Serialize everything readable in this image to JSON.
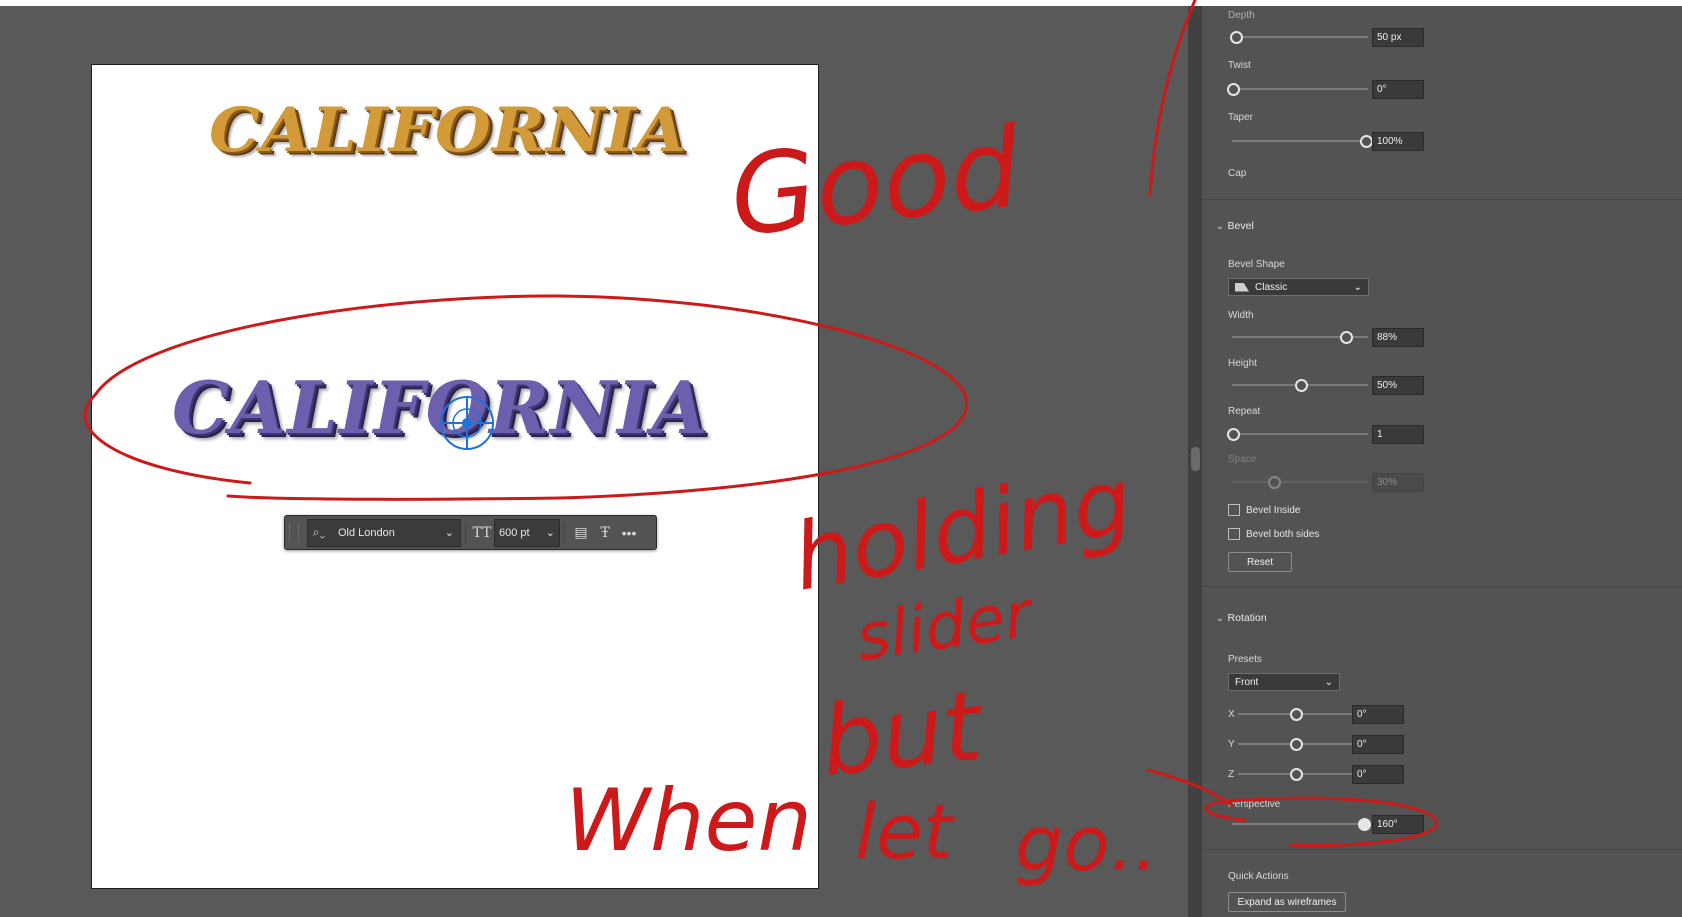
{
  "canvas": {
    "top_word": "CALIFORNIA",
    "bottom_word": "CALIFORNIA"
  },
  "context_bar": {
    "font_name": "Old London",
    "font_size": "600 pt"
  },
  "panel": {
    "depth": {
      "label": "Depth",
      "value": "50 px",
      "level": 0.02
    },
    "twist": {
      "label": "Twist",
      "value": "0°",
      "level": 0.0
    },
    "taper": {
      "label": "Taper",
      "value": "100%",
      "level": 1.0
    },
    "cap": {
      "label": "Cap"
    },
    "bevel": {
      "title": "Bevel",
      "shape_label": "Bevel Shape",
      "shape_value": "Classic",
      "width": {
        "label": "Width",
        "value": "88%",
        "level": 0.85
      },
      "height": {
        "label": "Height",
        "value": "50%",
        "level": 0.5
      },
      "repeat": {
        "label": "Repeat",
        "value": "1",
        "level": 0.0
      },
      "space": {
        "label": "Space",
        "value": "30%",
        "level": 0.3
      },
      "bevel_inside": "Bevel Inside",
      "bevel_both": "Bevel both sides",
      "reset": "Reset"
    },
    "rotation": {
      "title": "Rotation",
      "presets_label": "Presets",
      "preset_value": "Front",
      "x": {
        "label": "X",
        "value": "0°",
        "level": 0.5
      },
      "y": {
        "label": "Y",
        "value": "0°",
        "level": 0.5
      },
      "z": {
        "label": "Z",
        "value": "0°",
        "level": 0.5
      },
      "perspective": {
        "label": "Perspective",
        "value": "160°",
        "level": 1.0
      }
    },
    "quick_actions": {
      "title": "Quick Actions",
      "expand": "Expand as wireframes"
    }
  },
  "annotations": {
    "good": "Good",
    "holding": "holding",
    "slider": "slider",
    "but": "but",
    "when": "When",
    "let": "let",
    "go": "go..",
    "ink_color": "#cc1a1a"
  }
}
